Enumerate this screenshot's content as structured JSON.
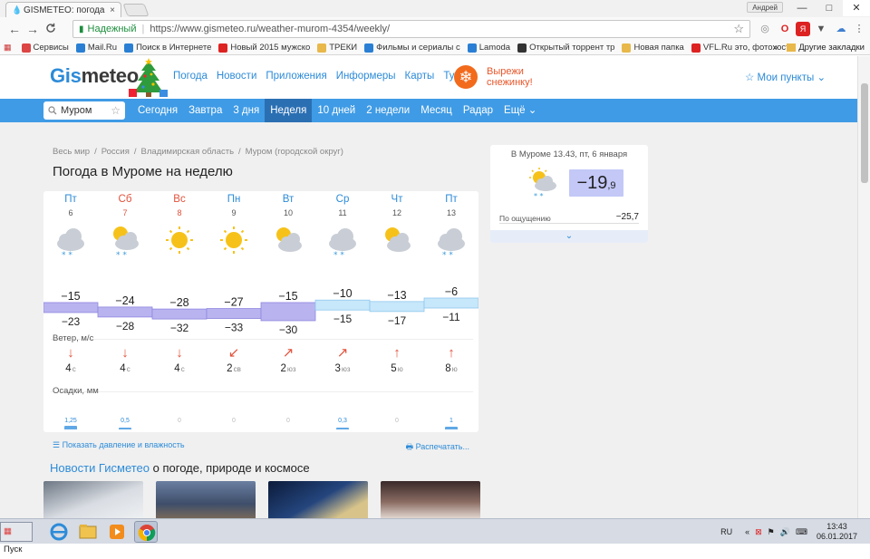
{
  "browser": {
    "tab_title": "GISMETEO: погода в Муро",
    "tab_close": "×",
    "user_badge": "Андрей",
    "win_min": "—",
    "win_max": "□",
    "win_close": "✕",
    "back": "←",
    "forward": "→",
    "reload": "C",
    "lock": "🔒",
    "secure_label": "Надежный",
    "url": "https://www.gismeteo.ru/weather-murom-4354/weekly/",
    "bookmarks": [
      "Сервисы",
      "Mail.Ru",
      "Поиск в Интернете",
      "Новый 2015 мужско",
      "ТРЕКИ",
      "Фильмы и сериалы с",
      "Lamoda",
      "Открытый торрент тр",
      "Новая папка",
      "VFL.Ru это, фотохост"
    ],
    "bookmarks_more": "»",
    "other_bookmarks": "Другие закладки",
    "bookmark_colors": [
      "#d44",
      "#2a7fd4",
      "#2a7fd4",
      "#d22",
      "#e8b84a",
      "#2a7fd4",
      "#2a7fd4",
      "#333",
      "#e8b84a",
      "#d22"
    ]
  },
  "site": {
    "logo_gis": "Gis",
    "logo_meteo": "meteo",
    "topnav": [
      "Погода",
      "Новости",
      "Приложения",
      "Информеры",
      "Карты",
      "Туризм"
    ],
    "promo_line1": "Вырежи",
    "promo_line2": "снежинку!",
    "my_points": "☆ Мои пункты ⌄",
    "search_value": "Муром",
    "search_star": "☆",
    "navtabs": [
      "Сегодня",
      "Завтра",
      "3 дня",
      "Неделя",
      "10 дней",
      "2 недели",
      "Месяц",
      "Радар",
      "Ещё ⌄"
    ],
    "active_tab": "Неделя"
  },
  "breadcrumb": [
    "Весь мир",
    "Россия",
    "Владимирская область",
    "Муром (городской округ)"
  ],
  "breadcrumb_sep": "/",
  "page_title": "Погода в Муроме на неделю",
  "forecast": {
    "days": [
      {
        "dow": "Пт",
        "date": "6",
        "weekend": false,
        "icon": "cloud-snow-icon",
        "max": "−15",
        "min": "−23",
        "wind_dir": "↓",
        "wind_speed": "4",
        "wind_unit": "с",
        "precip": "1,25",
        "precip_mm": 1.25
      },
      {
        "dow": "Сб",
        "date": "7",
        "weekend": true,
        "icon": "sun-cloud-snow-icon",
        "max": "−24",
        "min": "−28",
        "wind_dir": "↓",
        "wind_speed": "4",
        "wind_unit": "с",
        "precip": "0,5",
        "precip_mm": 0.5
      },
      {
        "dow": "Вс",
        "date": "8",
        "weekend": true,
        "icon": "sun-icon",
        "max": "−28",
        "min": "−32",
        "wind_dir": "↓",
        "wind_speed": "4",
        "wind_unit": "с",
        "precip": "0",
        "precip_mm": 0
      },
      {
        "dow": "Пн",
        "date": "9",
        "weekend": false,
        "icon": "sun-icon",
        "max": "−27",
        "min": "−33",
        "wind_dir": "↙",
        "wind_speed": "2",
        "wind_unit": "св",
        "precip": "0",
        "precip_mm": 0
      },
      {
        "dow": "Вт",
        "date": "10",
        "weekend": false,
        "icon": "sun-cloud-icon",
        "max": "−15",
        "min": "−30",
        "wind_dir": "↗",
        "wind_speed": "2",
        "wind_unit": "юз",
        "precip": "0",
        "precip_mm": 0
      },
      {
        "dow": "Ср",
        "date": "11",
        "weekend": false,
        "icon": "cloud-snow-icon",
        "max": "−10",
        "min": "−15",
        "wind_dir": "↗",
        "wind_speed": "3",
        "wind_unit": "юз",
        "precip": "0,3",
        "precip_mm": 0.3
      },
      {
        "dow": "Чт",
        "date": "12",
        "weekend": false,
        "icon": "sun-cloud-icon",
        "max": "−13",
        "min": "−17",
        "wind_dir": "↑",
        "wind_speed": "5",
        "wind_unit": "ю",
        "precip": "0",
        "precip_mm": 0
      },
      {
        "dow": "Пт",
        "date": "13",
        "weekend": false,
        "icon": "cloud-snow-icon",
        "max": "−6",
        "min": "−11",
        "wind_dir": "↑",
        "wind_speed": "8",
        "wind_unit": "ю",
        "precip": "1",
        "precip_mm": 1
      }
    ],
    "wind_label": "Ветер, м/с",
    "precip_label": "Осадки, мм",
    "show_pressure": "Показать давление и влажность",
    "print": "Распечатать..."
  },
  "news": {
    "title_brand": "Новости Гисметео",
    "title_rest": " о погоде, природе и космосе"
  },
  "widget": {
    "title": "В Муроме 13.43, пт, 6 января",
    "temp_main": "−19",
    "temp_frac": ",9",
    "feels_label": "По ощущению",
    "feels_value": "−25,7",
    "expand": "⌄"
  },
  "taskbar": {
    "start": "Пуск",
    "lang": "RU",
    "time": "13:43",
    "date": "06.01.2017"
  },
  "colors": {
    "accent": "#2d8bd8",
    "nav_bg": "#3f9be5",
    "nav_active": "#2b6fb3",
    "weekend": "#e2523c",
    "wind_arrow": "#e2523c",
    "temp_purple": "#b9b4ef",
    "temp_light": "#c7e7fa"
  }
}
